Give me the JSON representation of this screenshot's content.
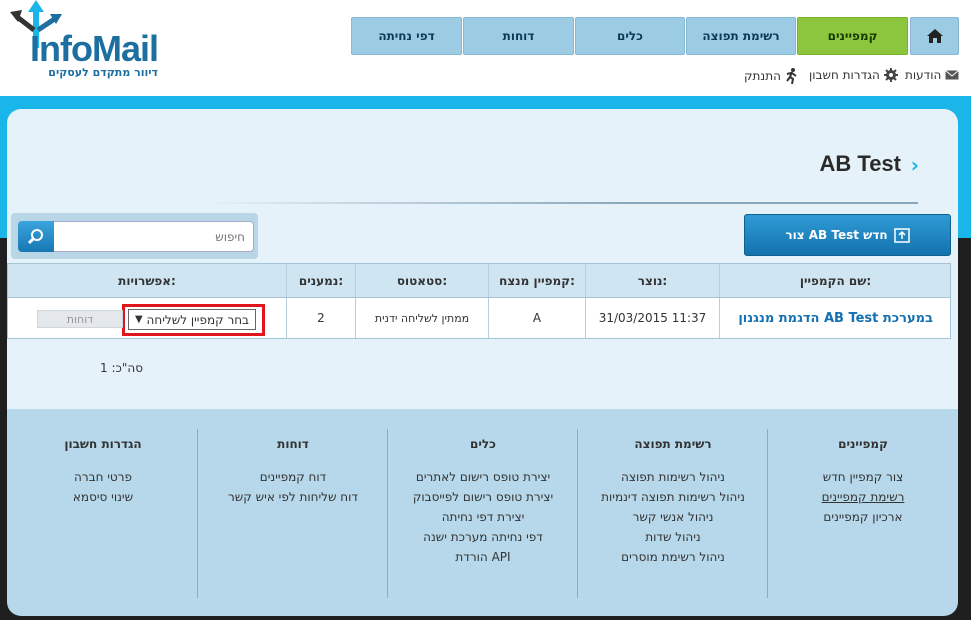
{
  "brand": {
    "logo_text": "InfoMail",
    "tagline": "דיוור מתקדם לעסקים"
  },
  "nav": {
    "home_icon": "home-icon",
    "items": [
      "קמפיינים",
      "רשימת תפוצה",
      "כלים",
      "דוחות",
      "דפי נחיתה"
    ]
  },
  "utility": {
    "messages": "הודעות",
    "settings": "הגדרות חשבון",
    "logout": "התנתק"
  },
  "page": {
    "title": "AB Test",
    "new_button": "צור AB Test חדש",
    "search_placeholder": "חיפוש"
  },
  "table": {
    "headers": [
      "שם הקמפיין:",
      "נוצר:",
      "קמפיין מנצח:",
      "סטאטוס:",
      "נמענים:",
      "אפשרויות:"
    ],
    "rows": [
      {
        "name": "הדגמת מנגנון AB Test במערכת",
        "created": "31/03/2015 11:37",
        "winner": "A",
        "status": "ממתין לשליחה ידנית",
        "recipients": "2",
        "select_value": "בחר קמפיין לשליחה",
        "reports": "דוחות"
      }
    ],
    "total": "סה\"כ: 1"
  },
  "footer": {
    "columns": [
      {
        "title": "קמפיינים",
        "links": [
          "צור קמפיין חדש",
          "רשימת קמפיינים",
          "ארכיון קמפיינים"
        ]
      },
      {
        "title": "רשימת תפוצה",
        "links": [
          "ניהול רשימות תפוצה",
          "ניהול רשימות תפוצה דינמיות",
          "ניהול אנשי קשר",
          "ניהול שדות",
          "ניהול רשימת מוסרים"
        ]
      },
      {
        "title": "כלים",
        "links": [
          "יצירת טופס רישום לאתרים",
          "יצירת טופס רישום לפייסבוק",
          "יצירת דפי נחיתה",
          "דפי נחיתה מערכת ישנה",
          "הורדת API"
        ]
      },
      {
        "title": "דוחות",
        "links": [
          "דוח קמפיינים",
          "דוח שליחות לפי איש קשר"
        ]
      },
      {
        "title": "הגדרות חשבון",
        "links": [
          "פרטי חברה",
          "שינוי סיסמא"
        ]
      }
    ]
  },
  "colors": {
    "accent_blue": "#1ab6ea",
    "nav_active": "#8cc63e",
    "highlight_red": "#e0161b"
  }
}
